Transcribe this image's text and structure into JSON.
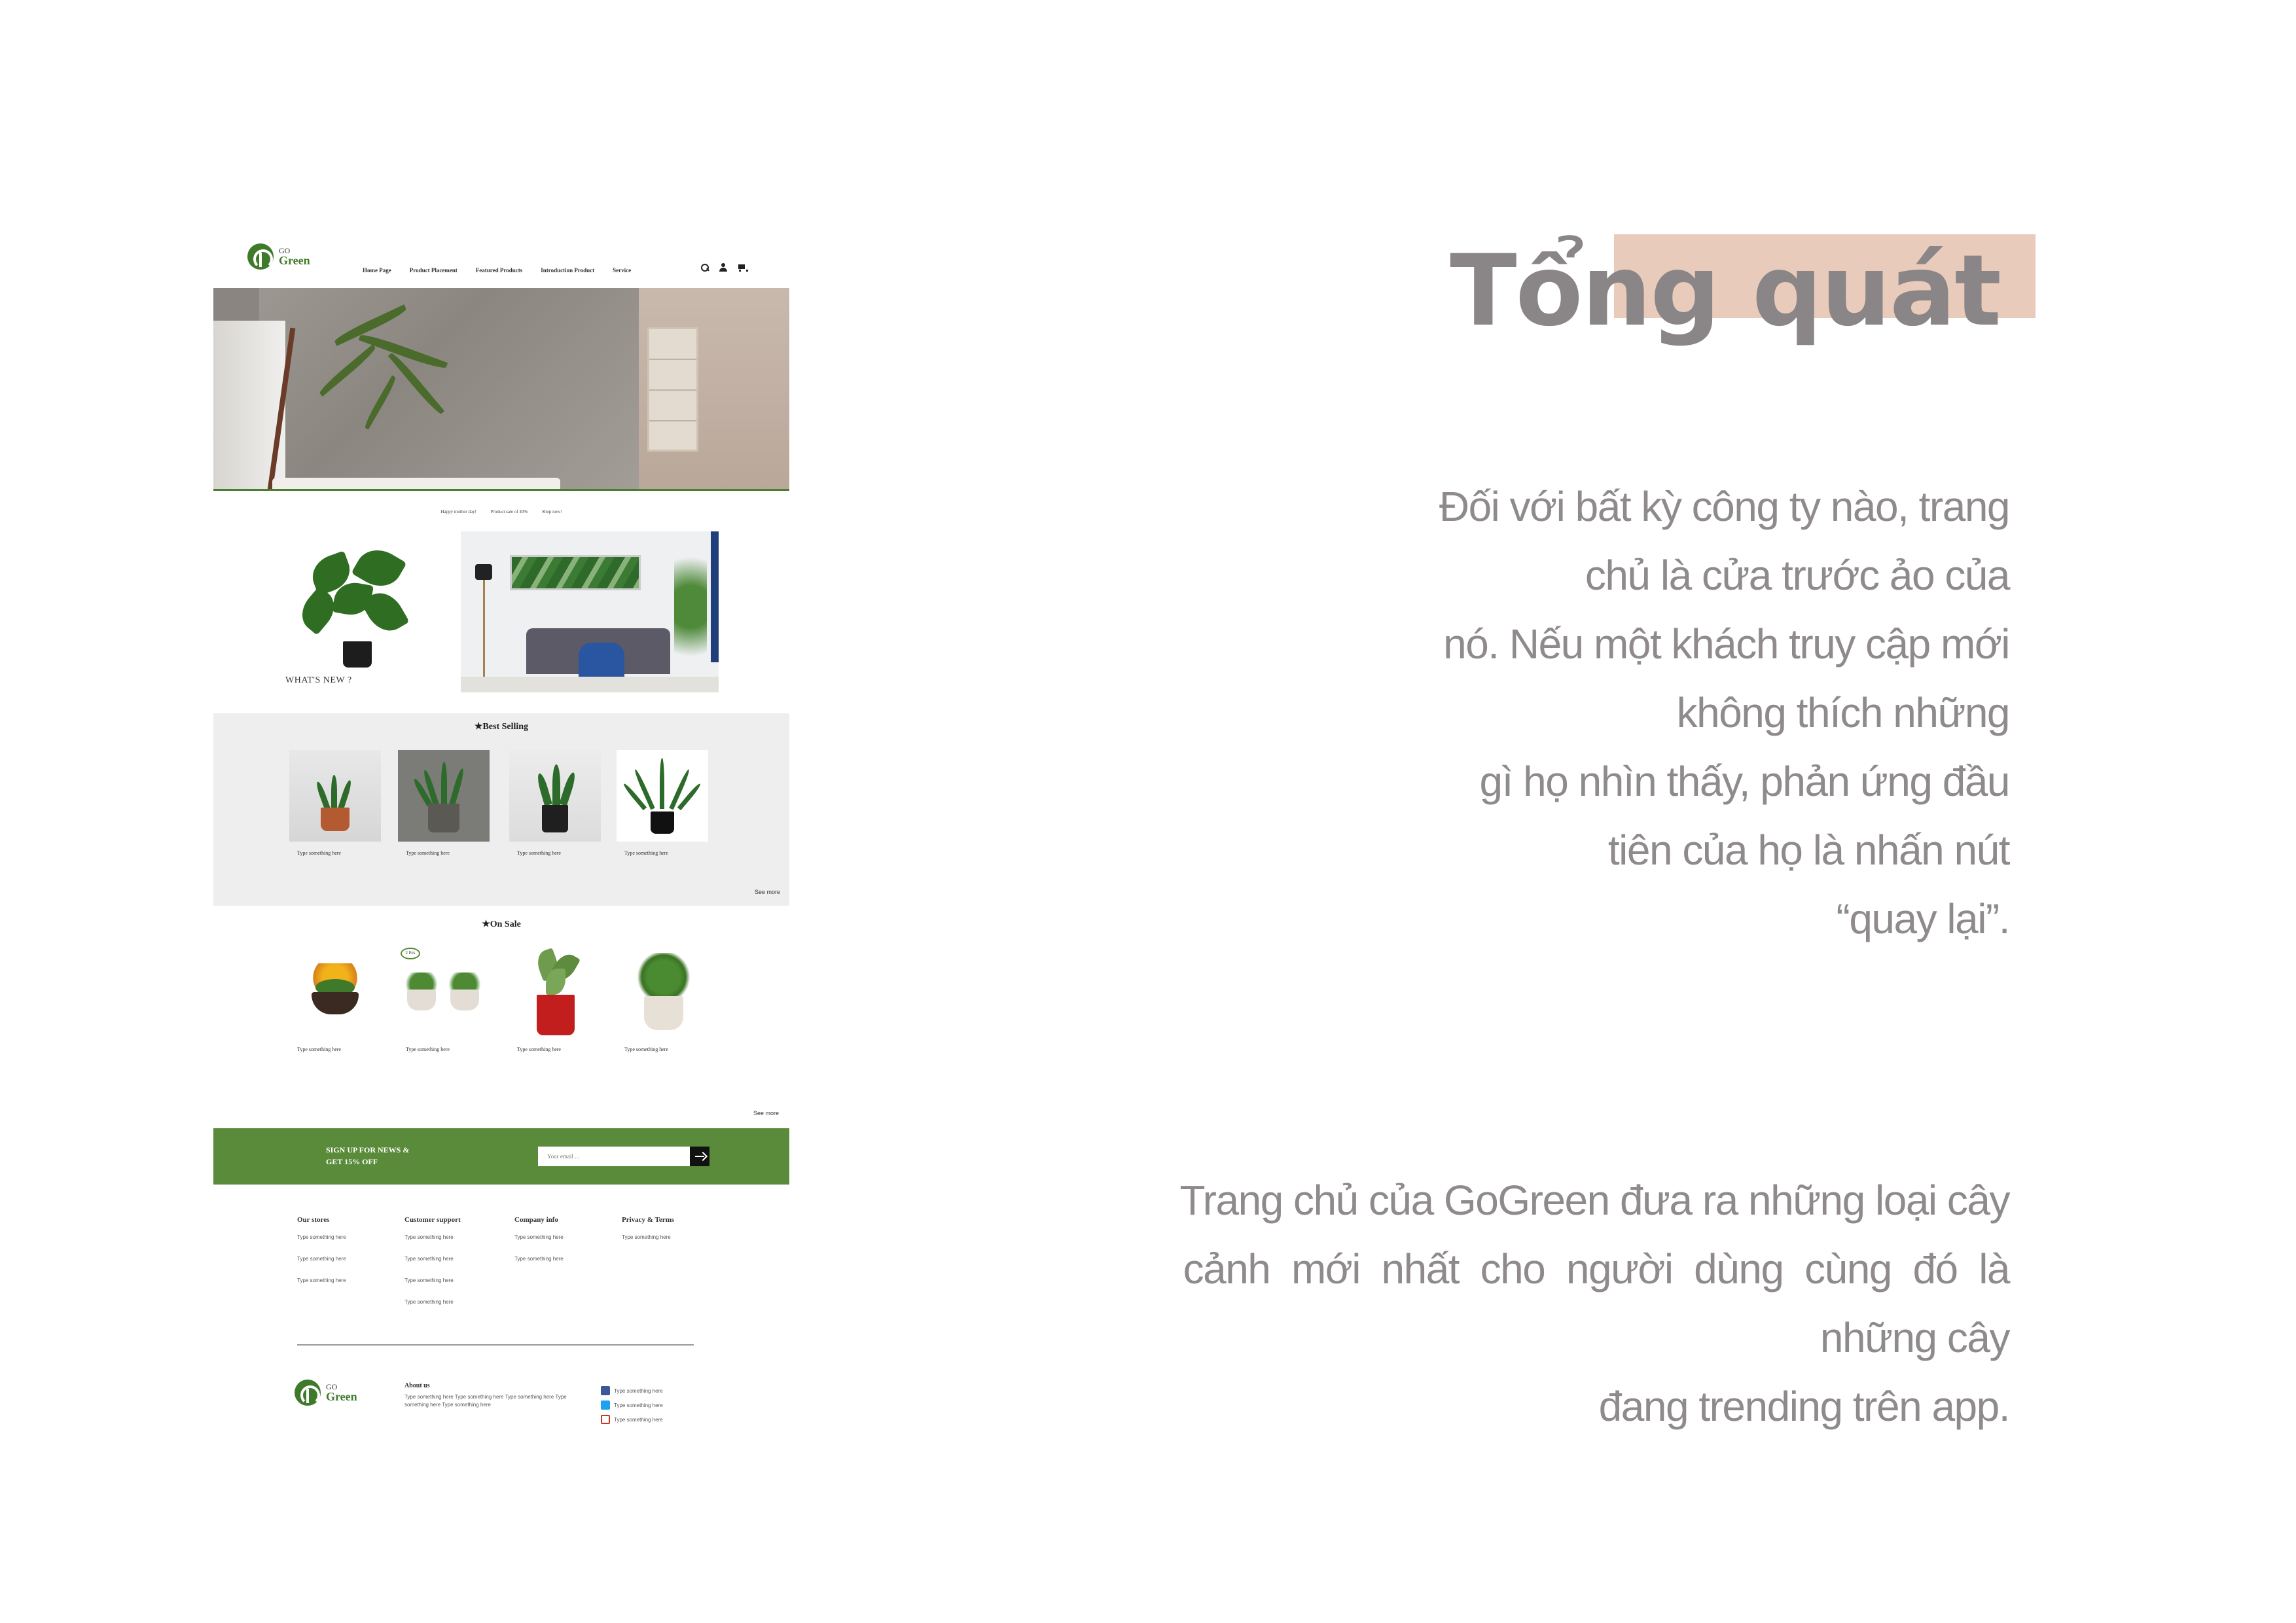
{
  "site": {
    "logo_go": "GO",
    "logo_green": "Green",
    "nav": [
      "Home Page",
      "Product Placement",
      "Featured Products",
      "Introduction Product",
      "Service"
    ],
    "promo": [
      "Happy mother day!",
      "Product sale of 40%",
      "Shop now!"
    ],
    "whats_new": "WHAT'S NEW ?",
    "best_selling": {
      "title": "★Best Selling",
      "items": [
        "Type something here",
        "Type something here",
        "Type something here",
        "Type something here"
      ],
      "see_more": "See more"
    },
    "on_sale": {
      "title": "★On Sale",
      "badge": "2 Pcs",
      "items": [
        "Type something here",
        "Type something here",
        "Type something here",
        "Type something here"
      ],
      "see_more": "See more"
    },
    "newsletter": {
      "line1": "SIGN UP FOR NEWS &",
      "line2": "GET 15% OFF",
      "placeholder": "Your email ..."
    },
    "footer": {
      "columns": [
        {
          "title": "Our stores",
          "items": [
            "Type something here",
            "Type something here",
            "Type something here"
          ]
        },
        {
          "title": "Customer support",
          "items": [
            "Type something here",
            "Type something here",
            "Type something here",
            "Type something here"
          ]
        },
        {
          "title": "Company info",
          "items": [
            "Type something here",
            "Type something here"
          ]
        },
        {
          "title": "Privacy & Terms",
          "items": [
            "Type something here"
          ]
        }
      ],
      "about_title": "About us",
      "about_text": "Type something here Type something here Type something here Type something here Type something here",
      "social": [
        "Type something here",
        "Type something here",
        "Type something here"
      ]
    }
  },
  "panel": {
    "title": "Tổng quát",
    "paragraph1": [
      "Đối với bất kỳ công ty nào, trang",
      "chủ là cửa trước ảo của",
      "nó. Nếu một khách truy cập mới",
      "không thích những",
      "gì họ nhìn thấy, phản ứng đầu",
      "tiên của họ là nhấn nút",
      "“quay lại”."
    ],
    "paragraph2": [
      "Trang chủ của GoGreen đưa ra những loại cây",
      "cảnh  mới  nhất  cho  người  dùng  cùng  đó  là",
      "những cây",
      "đang trending trên app."
    ]
  },
  "colors": {
    "brand_green": "#5a8b3a",
    "title_highlight": "#e8cbbb",
    "text_gray": "#8f8a8b"
  }
}
